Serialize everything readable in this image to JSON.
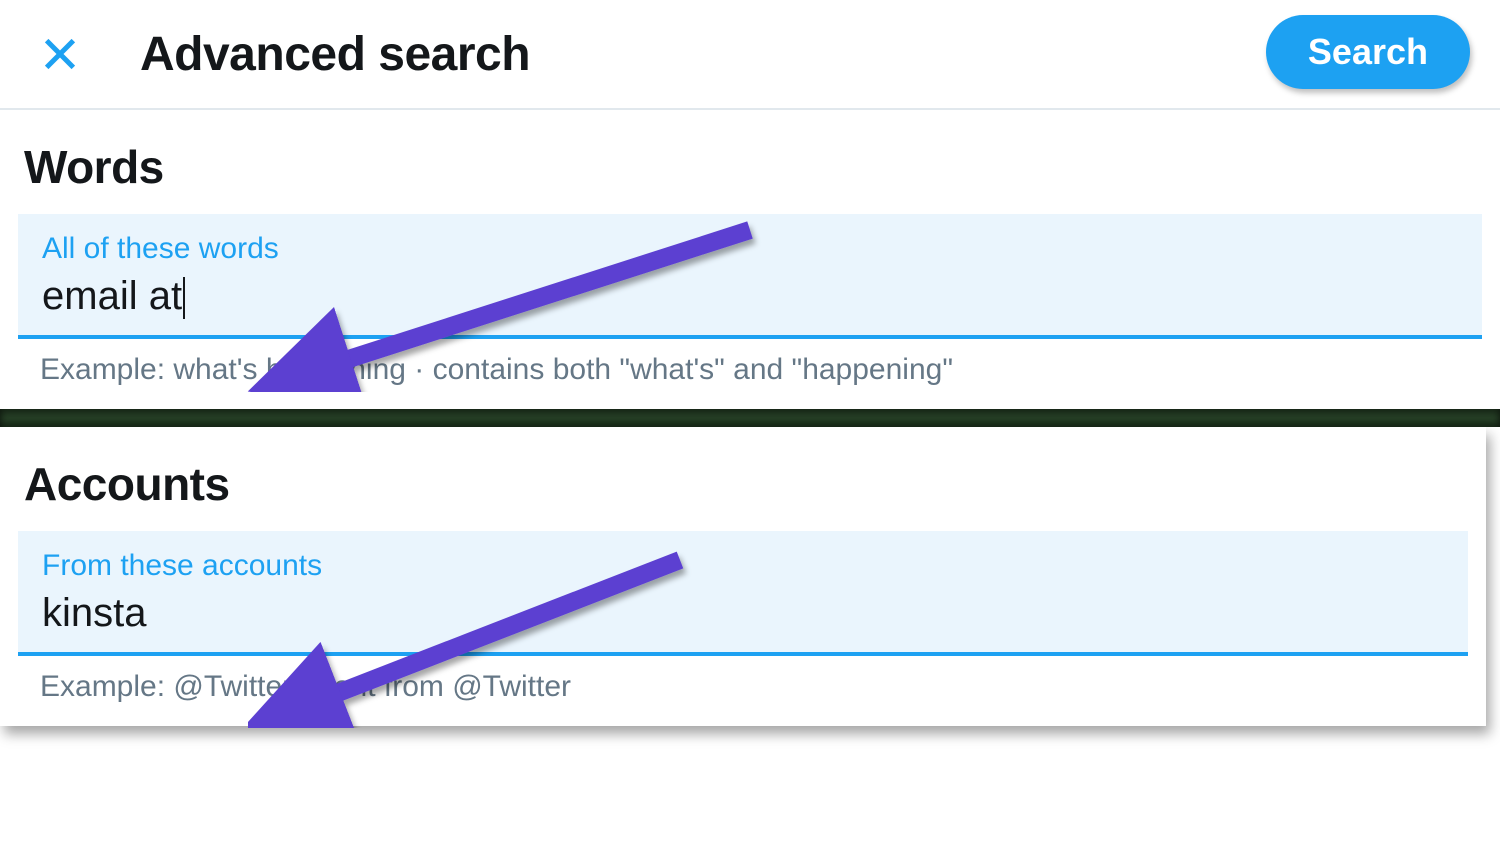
{
  "header": {
    "title": "Advanced search",
    "search_label": "Search"
  },
  "words": {
    "section_title": "Words",
    "field_label": "All of these words",
    "field_value": "email at",
    "hint": "Example: what's happening · contains both \"what's\" and \"happening\""
  },
  "accounts": {
    "section_title": "Accounts",
    "field_label": "From these accounts",
    "field_value": "kinsta",
    "hint": "Example: @Twitter · sent from @Twitter"
  },
  "colors": {
    "accent": "#1da1f2",
    "annotation_arrow": "#5b3fd1"
  }
}
